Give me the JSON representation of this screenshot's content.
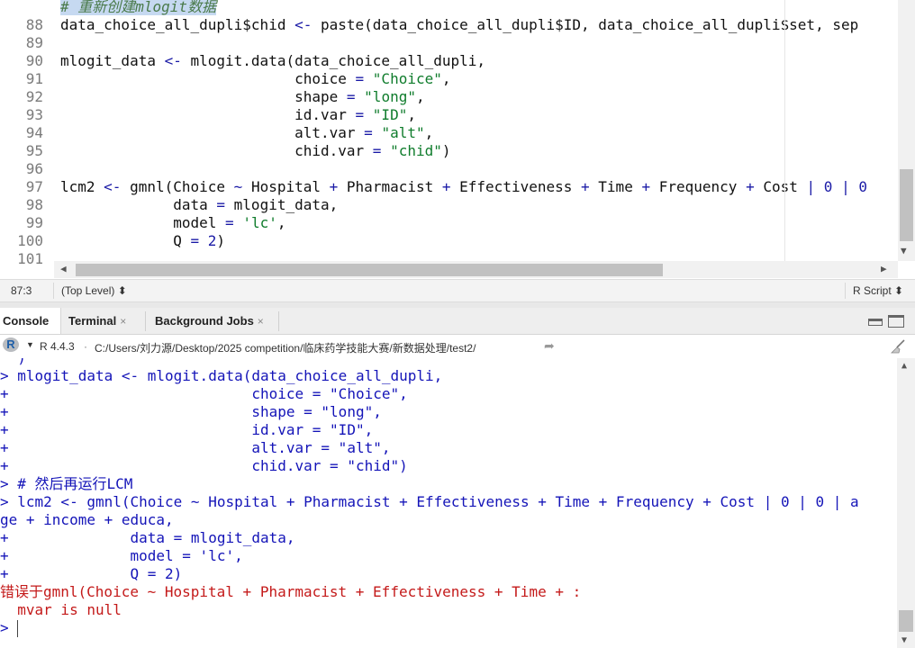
{
  "editor": {
    "lines": [
      {
        "n": "",
        "text": "# 重新创建mlogit数据"
      },
      {
        "n": "88",
        "text": "data_choice_all_dupli$chid <- paste(data_choice_all_dupli$ID, data_choice_all_dupli$set, sep"
      },
      {
        "n": "89",
        "text": ""
      },
      {
        "n": "90",
        "text": "mlogit_data <- mlogit.data(data_choice_all_dupli,"
      },
      {
        "n": "91",
        "text": "                           choice = \"Choice\","
      },
      {
        "n": "92",
        "text": "                           shape = \"long\","
      },
      {
        "n": "93",
        "text": "                           id.var = \"ID\","
      },
      {
        "n": "94",
        "text": "                           alt.var = \"alt\","
      },
      {
        "n": "95",
        "text": "                           chid.var = \"chid\")"
      },
      {
        "n": "96",
        "text": ""
      },
      {
        "n": "97",
        "text": "lcm2 <- gmnl(Choice ~ Hospital + Pharmacist + Effectiveness + Time + Frequency + Cost | 0 | 0"
      },
      {
        "n": "98",
        "text": "             data = mlogit_data,"
      },
      {
        "n": "99",
        "text": "             model = 'lc',"
      },
      {
        "n": "100",
        "text": "             Q = 2)"
      },
      {
        "n": "101",
        "text": ""
      }
    ]
  },
  "statusbar": {
    "cursor_pos": "87:3",
    "scope": "(Top Level) ⬍",
    "file_type": "R Script ⬍"
  },
  "tabs": {
    "console": "Console",
    "terminal": "Terminal",
    "jobs": "Background Jobs",
    "close_glyph": "×"
  },
  "console_header": {
    "r_version": "R 4.4.3",
    "dot": "·",
    "path": "C:/Users/刘力源/Desktop/2025 competition/临床药学技能大赛/新数据处理/test2/"
  },
  "console": {
    "lines": [
      {
        "text": "  )",
        "cls": ""
      },
      {
        "text": "> mlogit_data <- mlogit.data(data_choice_all_dupli,",
        "cls": ""
      },
      {
        "text": "+                            choice = \"Choice\",",
        "cls": ""
      },
      {
        "text": "+                            shape = \"long\",",
        "cls": ""
      },
      {
        "text": "+                            id.var = \"ID\",",
        "cls": ""
      },
      {
        "text": "+                            alt.var = \"alt\",",
        "cls": ""
      },
      {
        "text": "+                            chid.var = \"chid\")",
        "cls": ""
      },
      {
        "text": "> # 然后再运行LCM",
        "cls": ""
      },
      {
        "text": "> lcm2 <- gmnl(Choice ~ Hospital + Pharmacist + Effectiveness + Time + Frequency + Cost | 0 | 0 | a",
        "cls": ""
      },
      {
        "text": "ge + income + educa,",
        "cls": ""
      },
      {
        "text": "+              data = mlogit_data,",
        "cls": ""
      },
      {
        "text": "+              model = 'lc',",
        "cls": ""
      },
      {
        "text": "+              Q = 2)",
        "cls": ""
      },
      {
        "text": "错误于gmnl(Choice ~ Hospital + Pharmacist + Effectiveness + Time + :",
        "cls": "err"
      },
      {
        "text": "  mvar is null",
        "cls": "err"
      },
      {
        "text": "> ",
        "cls": ""
      }
    ]
  },
  "colors": {
    "console_text": "#1414b8",
    "error_text": "#c41a1a",
    "string": "#0f7c2c"
  }
}
